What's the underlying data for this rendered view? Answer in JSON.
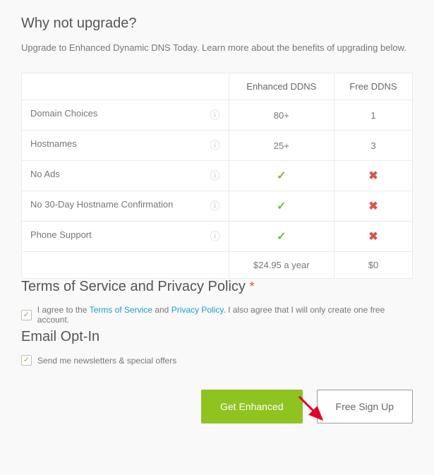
{
  "heading_upgrade": "Why not upgrade?",
  "lead": "Upgrade to Enhanced Dynamic DNS Today. Learn more about the benefits of upgrading below.",
  "table": {
    "col_enhanced": "Enhanced DDNS",
    "col_free": "Free DDNS",
    "rows": [
      {
        "label": "Domain Choices",
        "enhanced": "80+",
        "free": "1",
        "type": "text"
      },
      {
        "label": "Hostnames",
        "enhanced": "25+",
        "free": "3",
        "type": "text"
      },
      {
        "label": "No Ads",
        "enhanced": "true",
        "free": "false",
        "type": "bool"
      },
      {
        "label": "No 30-Day Hostname Confirmation",
        "enhanced": "true",
        "free": "false",
        "type": "bool"
      },
      {
        "label": "Phone Support",
        "enhanced": "true",
        "free": "false",
        "type": "bool"
      }
    ],
    "price_enhanced": "$24.95 a year",
    "price_free": "$0"
  },
  "tos_heading": "Terms of Service and Privacy Policy",
  "tos_prefix": "I agree to the ",
  "tos_link": "Terms of Service",
  "tos_and": " and ",
  "privacy_link": "Privacy Policy",
  "tos_suffix": ". I also agree that I will only create one free account.",
  "email_heading": "Email Opt-In",
  "email_optin_label": "Send me newsletters & special offers",
  "btn_enhanced": "Get Enhanced",
  "btn_free": "Free Sign Up"
}
